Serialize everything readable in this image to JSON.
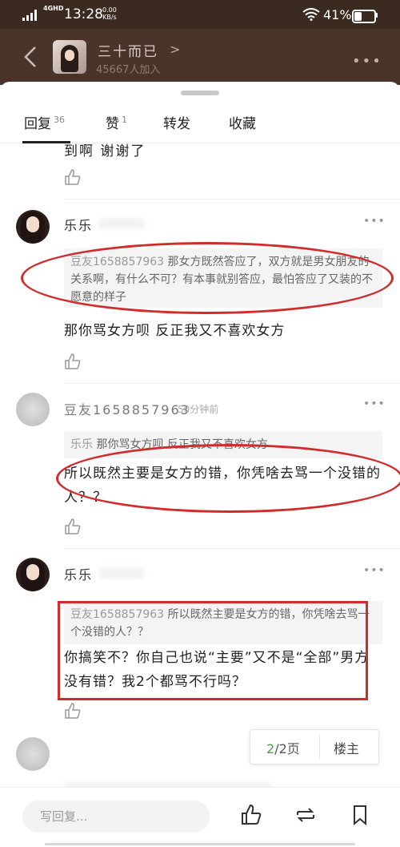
{
  "status_bar": {
    "network": "4GHD",
    "time": "13:28",
    "speed_value": "0.00",
    "speed_unit": "KB/s",
    "battery": "41%",
    "battery_level": 0.41
  },
  "header": {
    "group_name": "三十而已",
    "members": "45667人加入"
  },
  "tabs": [
    {
      "label": "回复",
      "count": "36"
    },
    {
      "label": "赞",
      "count": "1"
    },
    {
      "label": "转发",
      "count": ""
    },
    {
      "label": "收藏",
      "count": ""
    }
  ],
  "feed": {
    "cut_text": "到啊 谢谢了",
    "comments": [
      {
        "user": "乐乐",
        "time": "",
        "quote_name": "豆友1658857963",
        "quote_text": " 那女方既然答应了，双方就是男女朋友的关系啊，有什么不可？有本事就别答应，最怕答应了又装的不愿意的样子",
        "reply": "那你骂女方呗 反正我又不喜欢女方"
      },
      {
        "user": "豆友1658857963",
        "time": "50分钟前",
        "quote_name": "乐乐",
        "quote_text": " 那你骂女方呗 反正我又不喜欢女方",
        "reply": "所以既然主要是女方的错，你凭啥去骂一个没错的人？？"
      },
      {
        "user": "乐乐",
        "time": "",
        "quote_name": "豆友1658857963",
        "quote_text": " 所以既然主要是女方的错，你凭啥去骂一个没错的人？？",
        "reply": "你搞笑不？你自己也说“主要”又不是“全部”男方没有错？我2个都骂不行吗？"
      }
    ]
  },
  "pager": {
    "current": "2",
    "total": "/2页",
    "owner": "楼主"
  },
  "bottom": {
    "placeholder": "写回复..."
  }
}
